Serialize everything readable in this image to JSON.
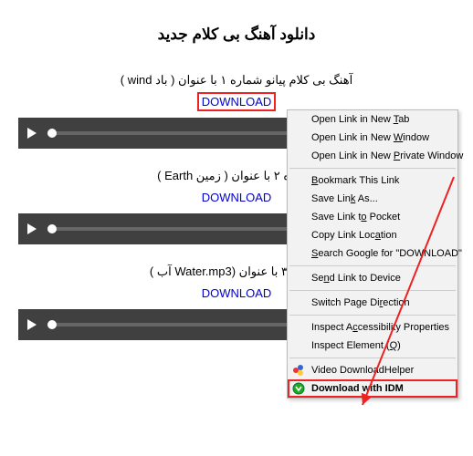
{
  "page_title": "دانلود آهنگ بی کلام جدید",
  "tracks": [
    {
      "title": "آهنگ بی کلام پیانو شماره ۱ با عنوان ( باد wind )",
      "download_label": "DOWNLOAD",
      "highlighted": true
    },
    {
      "title": "شماره ۲ با عنوان ( زمین Earth )",
      "download_label": "DOWNLOAD",
      "highlighted": false
    },
    {
      "title": "شماره ۳ با عنوان (Water.mp3 آب )",
      "download_label": "DOWNLOAD",
      "highlighted": false
    }
  ],
  "context_menu": {
    "groups": [
      [
        {
          "label_html": "Open Link in New <u>T</u>ab"
        },
        {
          "label_html": "Open Link in New <u>W</u>indow"
        },
        {
          "label_html": "Open Link in New <u>P</u>rivate Window"
        }
      ],
      [
        {
          "label_html": "<u>B</u>ookmark This Link"
        },
        {
          "label_html": "Save Lin<u>k</u> As..."
        },
        {
          "label_html": "Save Link t<u>o</u> Pocket"
        },
        {
          "label_html": "Copy Link Loc<u>a</u>tion"
        },
        {
          "label_html": "<u>S</u>earch Google for \"DOWNLOAD\""
        }
      ],
      [
        {
          "label_html": "Se<u>n</u>d Link to Device"
        }
      ],
      [
        {
          "label_html": "Switch Page Di<u>r</u>ection"
        }
      ],
      [
        {
          "label_html": "Inspect A<u>c</u>cessibility Properties"
        },
        {
          "label_html": "Inspect Element (<u>Q</u>)"
        }
      ],
      [
        {
          "label_html": "Video DownloadHelper",
          "icon": "vdh"
        },
        {
          "label_html": "Download with IDM",
          "icon": "idm",
          "highlighted": true
        }
      ]
    ]
  }
}
